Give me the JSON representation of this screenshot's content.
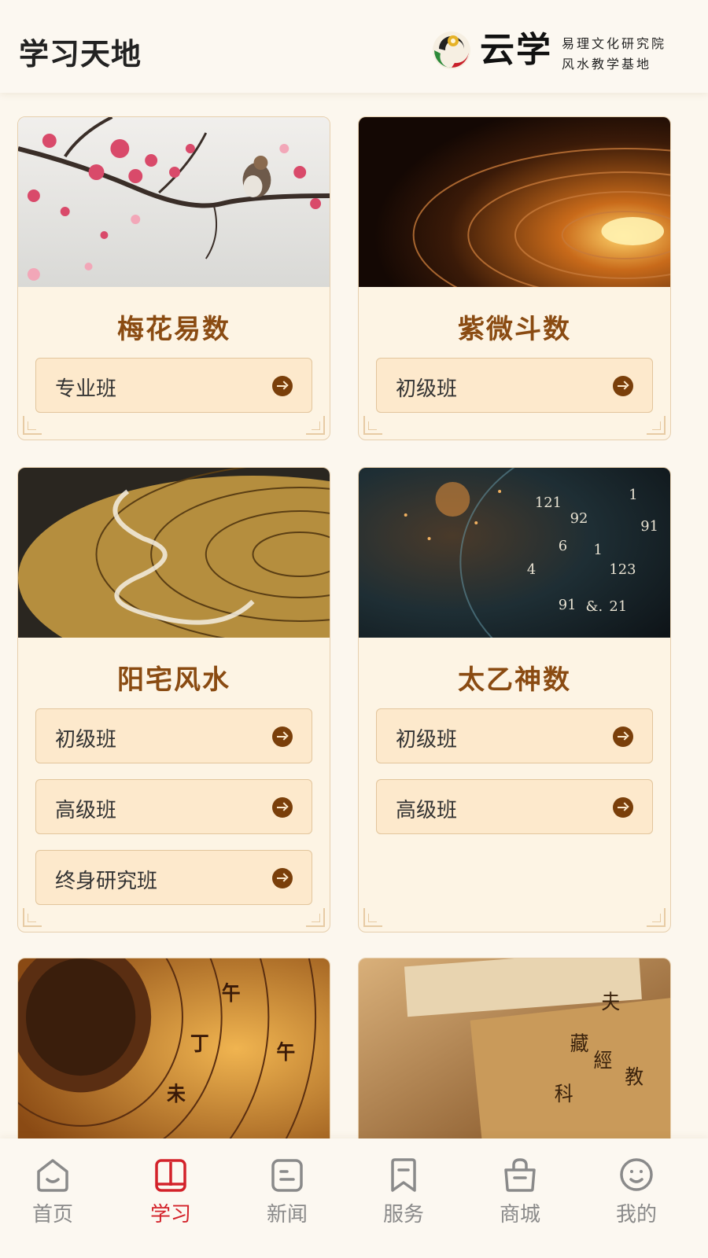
{
  "header": {
    "title": "学习天地",
    "logo_name": "云学",
    "logo_line1": "易理文化研究院",
    "logo_line2": "风水教学基地"
  },
  "courses": [
    {
      "title": "梅花易数",
      "classes": [
        {
          "label": "专业班"
        }
      ]
    },
    {
      "title": "紫微斗数",
      "classes": [
        {
          "label": "初级班"
        }
      ]
    },
    {
      "title": "阳宅风水",
      "classes": [
        {
          "label": "初级班"
        },
        {
          "label": "高级班"
        },
        {
          "label": "终身研究班"
        }
      ]
    },
    {
      "title": "太乙神数",
      "classes": [
        {
          "label": "初级班"
        },
        {
          "label": "高级班"
        }
      ]
    }
  ],
  "tabbar": {
    "items": [
      {
        "label": "首页",
        "icon": "home-face-icon"
      },
      {
        "label": "学习",
        "icon": "book-icon",
        "active": true
      },
      {
        "label": "新闻",
        "icon": "news-icon"
      },
      {
        "label": "服务",
        "icon": "bookmark-icon"
      },
      {
        "label": "商城",
        "icon": "shopping-bag-icon"
      },
      {
        "label": "我的",
        "icon": "smiley-face-icon"
      }
    ]
  },
  "colors": {
    "accent": "#d3222a",
    "title_brown": "#8a4b12",
    "pill_bg": "#fde9cc",
    "card_bg": "#fdf4e4"
  }
}
